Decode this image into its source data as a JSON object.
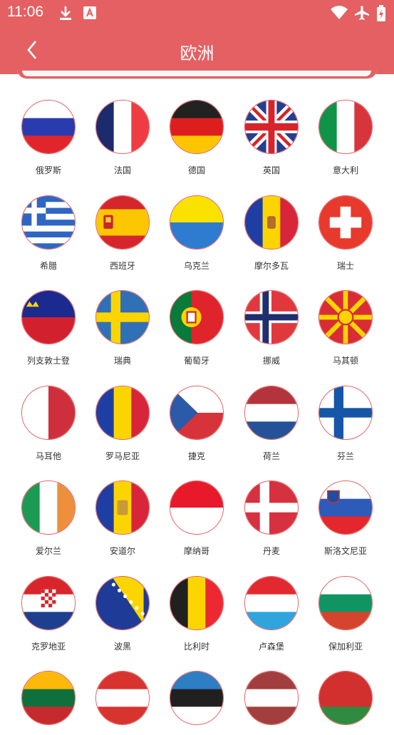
{
  "status": {
    "time": "11:06"
  },
  "header": {
    "title": "欧洲"
  },
  "colors": {
    "brand": "#e46062"
  },
  "flags": [
    {
      "label": "俄罗斯",
      "icon": "russia-flag"
    },
    {
      "label": "法国",
      "icon": "france-flag"
    },
    {
      "label": "德国",
      "icon": "germany-flag"
    },
    {
      "label": "英国",
      "icon": "uk-flag"
    },
    {
      "label": "意大利",
      "icon": "italy-flag"
    },
    {
      "label": "希腊",
      "icon": "greece-flag"
    },
    {
      "label": "西班牙",
      "icon": "spain-flag"
    },
    {
      "label": "乌克兰",
      "icon": "ukraine-flag"
    },
    {
      "label": "摩尔多瓦",
      "icon": "moldova-flag"
    },
    {
      "label": "瑞士",
      "icon": "switzerland-flag"
    },
    {
      "label": "列支敦士登",
      "icon": "liechtenstein-flag"
    },
    {
      "label": "瑞典",
      "icon": "sweden-flag"
    },
    {
      "label": "葡萄牙",
      "icon": "portugal-flag"
    },
    {
      "label": "挪威",
      "icon": "norway-flag"
    },
    {
      "label": "马其顿",
      "icon": "macedonia-flag"
    },
    {
      "label": "马耳他",
      "icon": "malta-flag"
    },
    {
      "label": "罗马尼亚",
      "icon": "romania-flag"
    },
    {
      "label": "捷克",
      "icon": "czech-flag"
    },
    {
      "label": "荷兰",
      "icon": "netherlands-flag"
    },
    {
      "label": "芬兰",
      "icon": "finland-flag"
    },
    {
      "label": "爱尔兰",
      "icon": "ireland-flag"
    },
    {
      "label": "安道尔",
      "icon": "andorra-flag"
    },
    {
      "label": "摩纳哥",
      "icon": "monaco-flag"
    },
    {
      "label": "丹麦",
      "icon": "denmark-flag"
    },
    {
      "label": "斯洛文尼亚",
      "icon": "slovenia-flag"
    },
    {
      "label": "克罗地亚",
      "icon": "croatia-flag"
    },
    {
      "label": "波黑",
      "icon": "bosnia-flag"
    },
    {
      "label": "比利时",
      "icon": "belgium-flag"
    },
    {
      "label": "卢森堡",
      "icon": "luxembourg-flag"
    },
    {
      "label": "保加利亚",
      "icon": "bulgaria-flag"
    },
    {
      "label": "",
      "icon": "lithuania-flag"
    },
    {
      "label": "",
      "icon": "austria-flag"
    },
    {
      "label": "",
      "icon": "estonia-flag"
    },
    {
      "label": "",
      "icon": "latvia-flag"
    },
    {
      "label": "",
      "icon": "belarus-flag"
    }
  ]
}
